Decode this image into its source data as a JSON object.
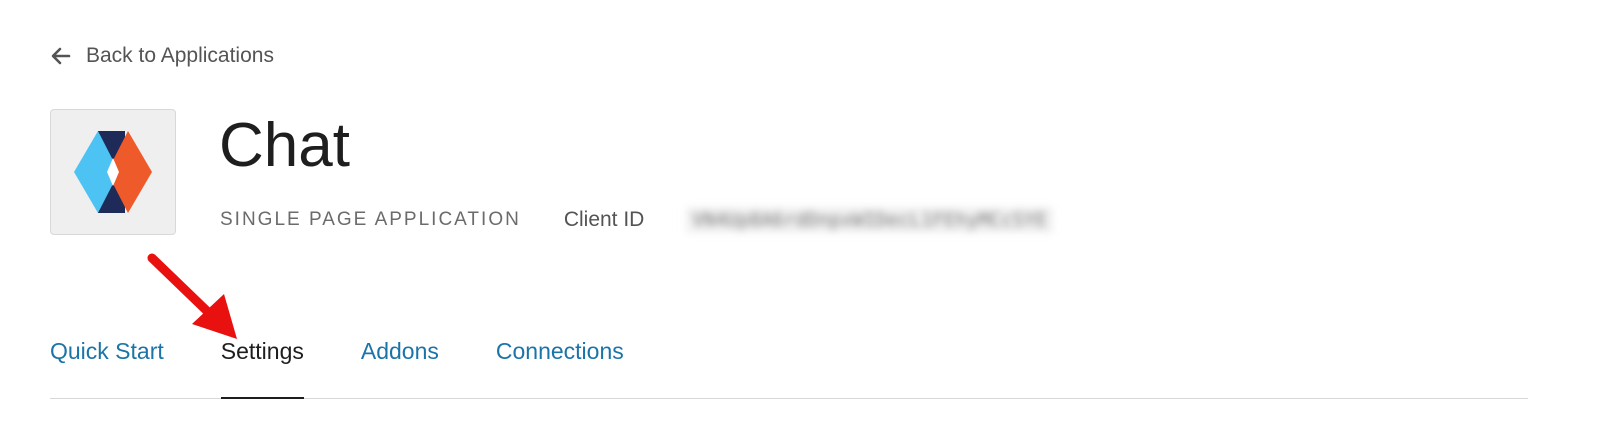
{
  "navigation": {
    "back_label": "Back to Applications",
    "back_icon": "arrow-left-icon"
  },
  "app": {
    "name": "Chat",
    "type": "SINGLE PAGE APPLICATION",
    "client_id_label": "Client ID",
    "client_id_value": "VN4Up8A6rdDnpxWIDecL1FEhyMCcSYE",
    "client_id_redacted": true,
    "logo_icon": "app-logo-icon",
    "logo_colors": {
      "blue": "#4cc3f2",
      "orange": "#ef5a2a",
      "navy": "#1e2a57"
    }
  },
  "annotation": {
    "arrow_color": "#e8110f",
    "arrow_icon": "red-annotation-arrow-icon"
  },
  "tabs": [
    {
      "label": "Quick Start",
      "active": false
    },
    {
      "label": "Settings",
      "active": true
    },
    {
      "label": "Addons",
      "active": false
    },
    {
      "label": "Connections",
      "active": false
    }
  ],
  "colors": {
    "link": "#1b74a8",
    "text": "#1e1e1e",
    "muted": "#6b6b6b"
  }
}
